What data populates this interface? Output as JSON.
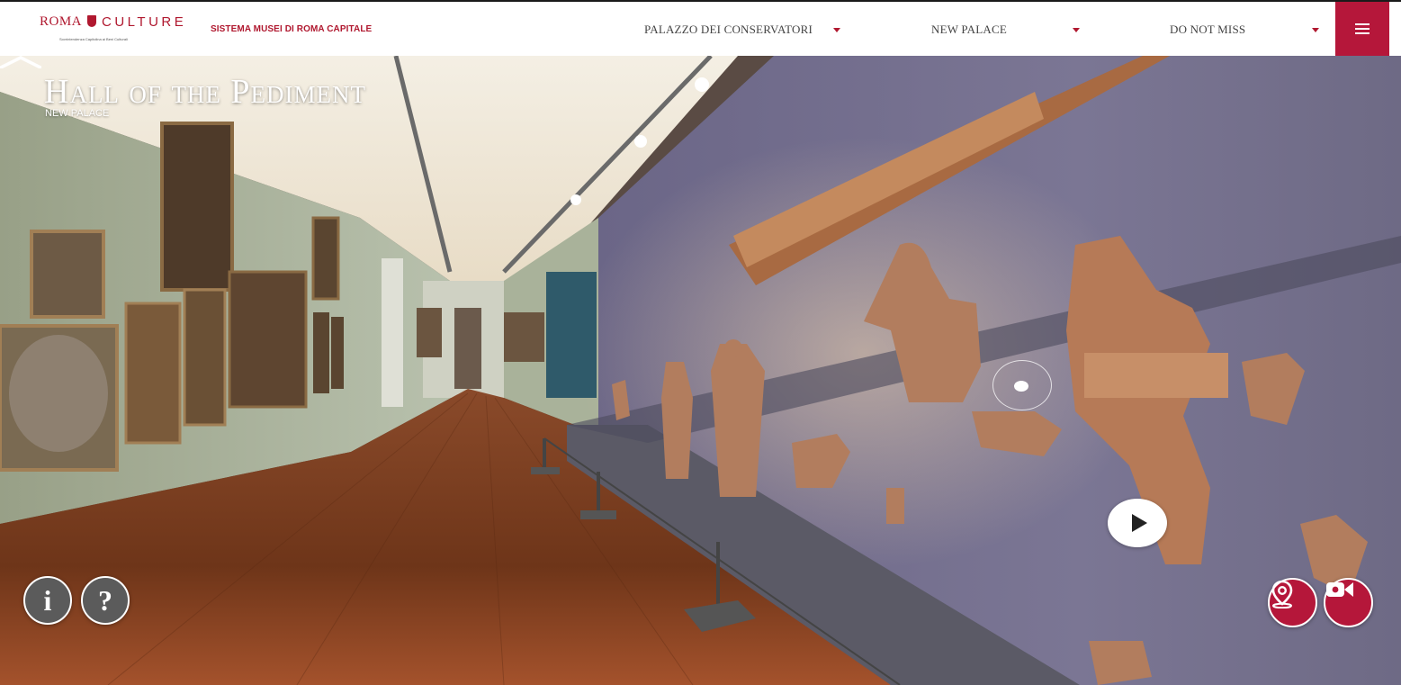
{
  "header": {
    "logo": {
      "roma": "ROMA",
      "culture": "CULTURE",
      "tagline": "Sovrintendenza Capitolina ai Beni Culturali"
    },
    "sistema": "SISTEMA MUSEI DI ROMA CAPITALE",
    "nav": [
      {
        "label": "PALAZZO DEI CONSERVATORI"
      },
      {
        "label": "NEW PALACE"
      },
      {
        "label": "DO NOT MISS"
      }
    ],
    "menu_icon": "hamburger-icon"
  },
  "room": {
    "title": "Hall of the Pediment",
    "subtitle": "NEW PALACE"
  },
  "controls": {
    "info_icon": "info-icon",
    "help_icon": "help-icon",
    "play_icon": "play-icon",
    "map_icon": "map-pin-icon",
    "video_icon": "video-camera-icon",
    "forward_icon": "chevron-up-icon"
  },
  "colors": {
    "brand": "#b5173a",
    "wall_left": "#a4ac93",
    "wall_right": "#6f6a86",
    "floor": "#7a3f22"
  }
}
